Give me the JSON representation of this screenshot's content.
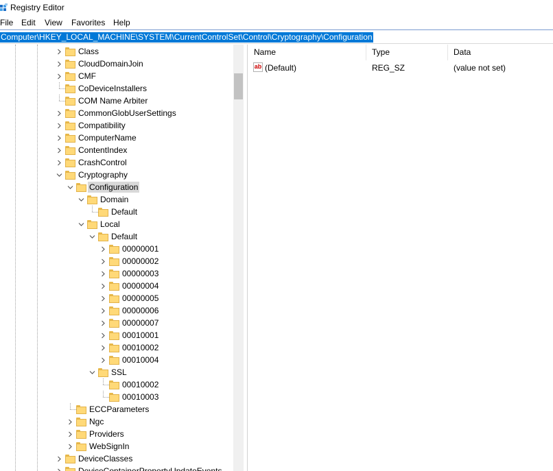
{
  "window": {
    "title": "Registry Editor"
  },
  "menu": [
    "File",
    "Edit",
    "View",
    "Favorites",
    "Help"
  ],
  "address": "Computer\\HKEY_LOCAL_MACHINE\\SYSTEM\\CurrentControlSet\\Control\\Cryptography\\Configuration",
  "tree": [
    {
      "label": "Class",
      "depth": 0,
      "exp": "collapsed"
    },
    {
      "label": "CloudDomainJoin",
      "depth": 0,
      "exp": "collapsed"
    },
    {
      "label": "CMF",
      "depth": 0,
      "exp": "collapsed"
    },
    {
      "label": "CoDeviceInstallers",
      "depth": 0,
      "exp": "none"
    },
    {
      "label": "COM Name Arbiter",
      "depth": 0,
      "exp": "none"
    },
    {
      "label": "CommonGlobUserSettings",
      "depth": 0,
      "exp": "collapsed"
    },
    {
      "label": "Compatibility",
      "depth": 0,
      "exp": "collapsed"
    },
    {
      "label": "ComputerName",
      "depth": 0,
      "exp": "collapsed"
    },
    {
      "label": "ContentIndex",
      "depth": 0,
      "exp": "collapsed"
    },
    {
      "label": "CrashControl",
      "depth": 0,
      "exp": "collapsed"
    },
    {
      "label": "Cryptography",
      "depth": 0,
      "exp": "expanded"
    },
    {
      "label": "Configuration",
      "depth": 1,
      "exp": "expanded",
      "selected": true
    },
    {
      "label": "Domain",
      "depth": 2,
      "exp": "expanded"
    },
    {
      "label": "Default",
      "depth": 3,
      "exp": "none"
    },
    {
      "label": "Local",
      "depth": 2,
      "exp": "expanded"
    },
    {
      "label": "Default",
      "depth": 3,
      "exp": "expanded"
    },
    {
      "label": "00000001",
      "depth": 4,
      "exp": "collapsed"
    },
    {
      "label": "00000002",
      "depth": 4,
      "exp": "collapsed"
    },
    {
      "label": "00000003",
      "depth": 4,
      "exp": "collapsed"
    },
    {
      "label": "00000004",
      "depth": 4,
      "exp": "collapsed"
    },
    {
      "label": "00000005",
      "depth": 4,
      "exp": "collapsed"
    },
    {
      "label": "00000006",
      "depth": 4,
      "exp": "collapsed"
    },
    {
      "label": "00000007",
      "depth": 4,
      "exp": "collapsed"
    },
    {
      "label": "00010001",
      "depth": 4,
      "exp": "collapsed"
    },
    {
      "label": "00010002",
      "depth": 4,
      "exp": "collapsed"
    },
    {
      "label": "00010004",
      "depth": 4,
      "exp": "collapsed"
    },
    {
      "label": "SSL",
      "depth": 3,
      "exp": "expanded"
    },
    {
      "label": "00010002",
      "depth": 4,
      "exp": "none"
    },
    {
      "label": "00010003",
      "depth": 4,
      "exp": "none"
    },
    {
      "label": "ECCParameters",
      "depth": 1,
      "exp": "none"
    },
    {
      "label": "Ngc",
      "depth": 1,
      "exp": "collapsed"
    },
    {
      "label": "Providers",
      "depth": 1,
      "exp": "collapsed"
    },
    {
      "label": "WebSignIn",
      "depth": 1,
      "exp": "collapsed"
    },
    {
      "label": "DeviceClasses",
      "depth": 0,
      "exp": "collapsed"
    },
    {
      "label": "DeviceContainerPropertyUpdateEvents",
      "depth": 0,
      "exp": "collapsed"
    }
  ],
  "columns": [
    "Name",
    "Type",
    "Data"
  ],
  "values": [
    {
      "name": "(Default)",
      "type": "REG_SZ",
      "data": "(value not set)",
      "icon": "string-value-icon"
    }
  ],
  "colors": {
    "selection": "#0078d7",
    "folder": "#ffd978",
    "tree_selected": "#d9d9d9"
  }
}
